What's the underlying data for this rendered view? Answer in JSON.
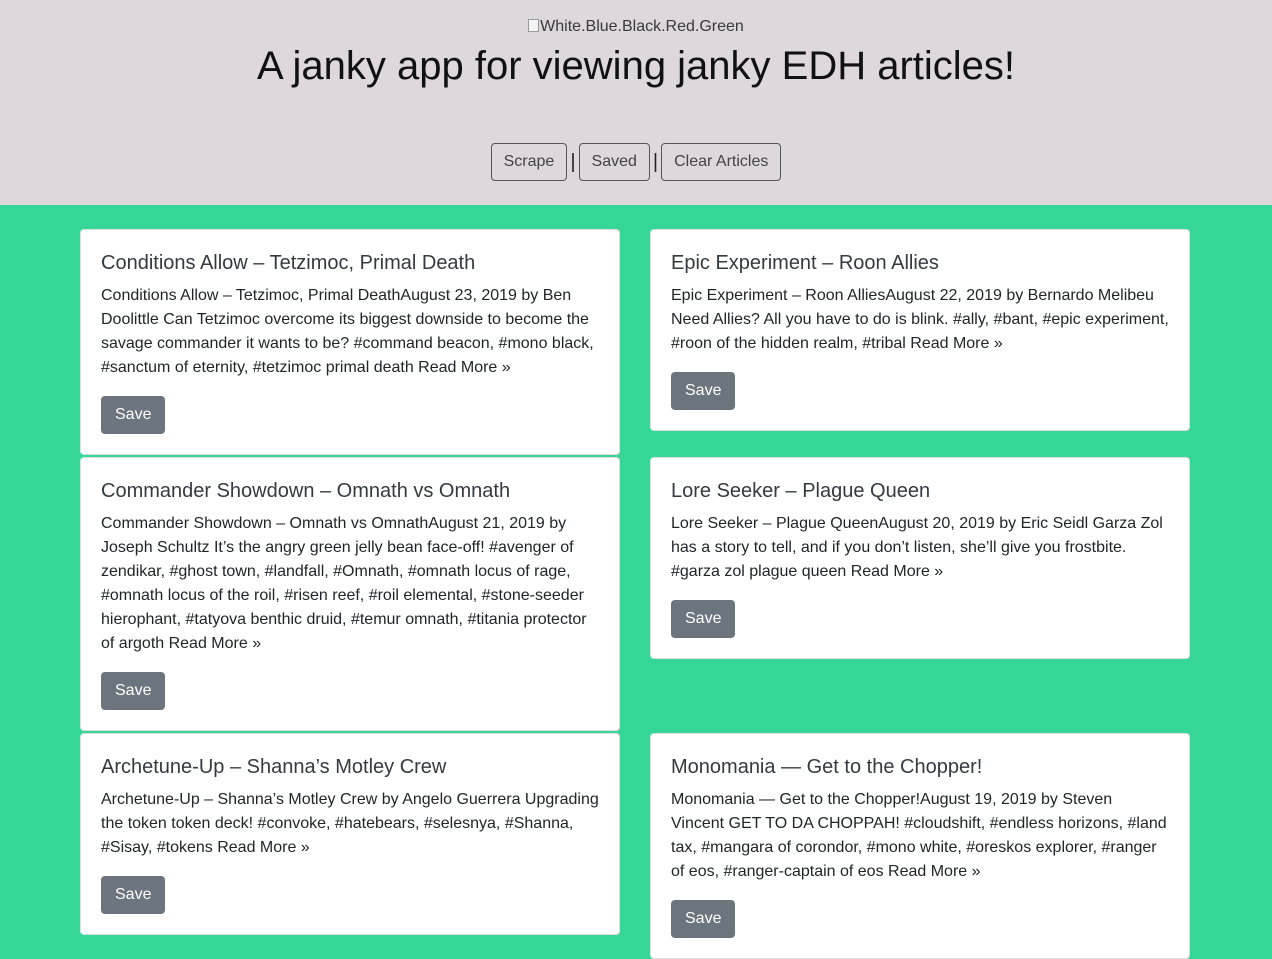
{
  "header": {
    "logo_alt": "White.Blue.Black.Red.Green",
    "title": "A janky app for viewing janky EDH articles!",
    "nav": {
      "scrape": "Scrape",
      "saved": "Saved",
      "clear": "Clear Articles",
      "separator": "|"
    }
  },
  "articles": [
    {
      "title": "Conditions Allow – Tetzimoc, Primal Death",
      "summary": "Conditions Allow – Tetzimoc, Primal DeathAugust 23, 2019 by Ben Doolittle Can Tetzimoc overcome its biggest downside to become the savage commander it wants to be? #command beacon, #mono black, #sanctum of eternity, #tetzimoc primal death Read More »",
      "save_label": "Save"
    },
    {
      "title": "Epic Experiment – Roon Allies",
      "summary": "Epic Experiment – Roon AlliesAugust 22, 2019 by Bernardo Melibeu Need Allies? All you have to do is blink. #ally, #bant, #epic experiment, #roon of the hidden realm, #tribal Read More »",
      "save_label": "Save"
    },
    {
      "title": "Commander Showdown – Omnath vs Omnath",
      "summary": "Commander Showdown – Omnath vs OmnathAugust 21, 2019 by Joseph Schultz It’s the angry green jelly bean face-off! #avenger of zendikar, #ghost town, #landfall, #Omnath, #omnath locus of rage, #omnath locus of the roil, #risen reef, #roil elemental, #stone-seeder hierophant, #tatyova benthic druid, #temur omnath, #titania protector of argoth Read More »",
      "save_label": "Save"
    },
    {
      "title": "Lore Seeker – Plague Queen",
      "summary": "Lore Seeker – Plague QueenAugust 20, 2019 by Eric Seidl Garza Zol has a story to tell, and if you don’t listen, she’ll give you frostbite. #garza zol plague queen Read More »",
      "save_label": "Save"
    },
    {
      "title": "Archetune-Up – Shanna’s Motley Crew",
      "summary": "Archetune-Up – Shanna’s Motley Crew by Angelo Guerrera Upgrading the token token deck! #convoke, #hatebears, #selesnya, #Shanna, #Sisay, #tokens Read More »",
      "save_label": "Save"
    },
    {
      "title": "Monomania — Get to the Chopper!",
      "summary": "Monomania — Get to the Chopper!August 19, 2019 by Steven Vincent GET TO DA CHOPPAH! #cloudshift, #endless horizons, #land tax, #mangara of corondor, #mono white, #oreskos explorer, #ranger of eos, #ranger-captain of eos Read More »",
      "save_label": "Save"
    }
  ],
  "colors": {
    "header_bg": "#ded7dc",
    "page_bg": "#36d696",
    "save_button": "#6c757d"
  }
}
